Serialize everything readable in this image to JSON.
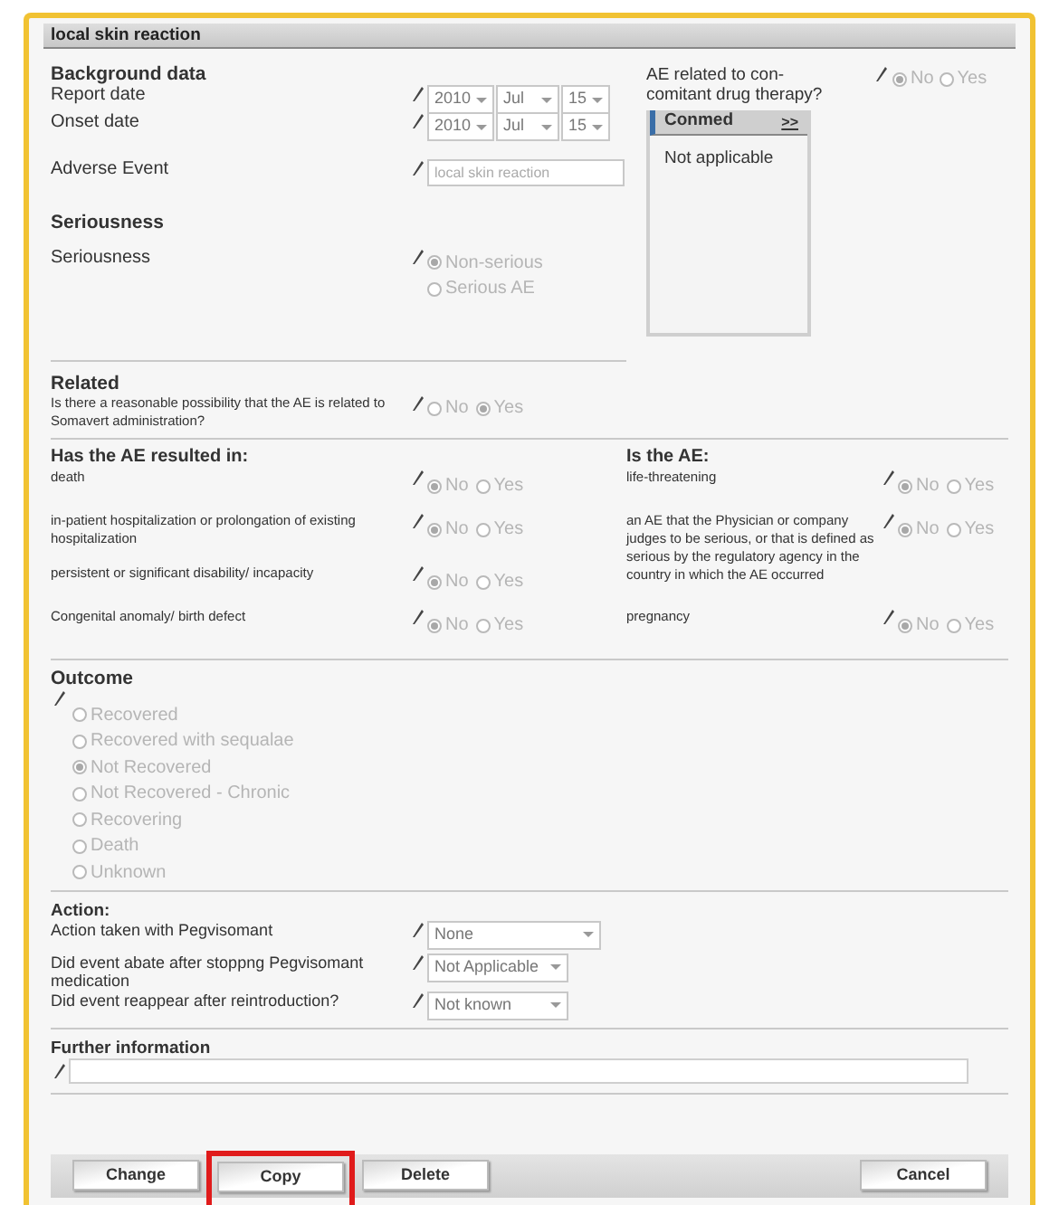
{
  "panel": {
    "title": "local skin reaction"
  },
  "background": {
    "heading": "Background data",
    "dates": [
      {
        "label": "Report date",
        "year": "2010",
        "month": "Jul",
        "day": "15"
      },
      {
        "label": "Onset date",
        "year": "2010",
        "month": "Jul",
        "day": "15"
      }
    ],
    "adverse_event": {
      "label": "Adverse Event",
      "value": "local skin reaction"
    }
  },
  "conmed": {
    "question": "AE related to con-comitant drug therapy?",
    "options": [
      {
        "label": "No",
        "selected": true
      },
      {
        "label": "Yes",
        "selected": false
      }
    ],
    "box_title": "Conmed",
    "expand": ">>",
    "content": "Not applicable"
  },
  "seriousness": {
    "heading": "Seriousness",
    "label": "Seriousness",
    "options": [
      {
        "label": "Non-serious",
        "selected": true
      },
      {
        "label": "Serious AE",
        "selected": false
      }
    ]
  },
  "related": {
    "heading": "Related",
    "question": "Is there a reasonable possibility that the AE is related to Somavert administration?",
    "options": [
      {
        "label": "No",
        "selected": false
      },
      {
        "label": "Yes",
        "selected": true
      }
    ]
  },
  "resulted_in": {
    "heading": "Has the AE resulted in:",
    "items": [
      {
        "label": "death",
        "options": [
          {
            "label": "No",
            "selected": true
          },
          {
            "label": "Yes",
            "selected": false
          }
        ]
      },
      {
        "label": "in-patient hospitalization or prolongation of existing hospitalization",
        "options": [
          {
            "label": "No",
            "selected": true
          },
          {
            "label": "Yes",
            "selected": false
          }
        ]
      },
      {
        "label": "persistent or significant disability/ incapacity",
        "options": [
          {
            "label": "No",
            "selected": true
          },
          {
            "label": "Yes",
            "selected": false
          }
        ]
      },
      {
        "label": "Congenital anomaly/ birth defect",
        "options": [
          {
            "label": "No",
            "selected": true
          },
          {
            "label": "Yes",
            "selected": false
          }
        ]
      }
    ]
  },
  "is_the_ae": {
    "heading": "Is the AE:",
    "items": [
      {
        "label": "life-threatening",
        "options": [
          {
            "label": "No",
            "selected": true
          },
          {
            "label": "Yes",
            "selected": false
          }
        ]
      },
      {
        "label": "an AE that the Physician or company judges to be serious, or that is defined as serious by the regulatory agency in the country in which the AE occurred",
        "options": [
          {
            "label": "No",
            "selected": true
          },
          {
            "label": "Yes",
            "selected": false
          }
        ]
      },
      {
        "label": "pregnancy",
        "options": [
          {
            "label": "No",
            "selected": true
          },
          {
            "label": "Yes",
            "selected": false
          }
        ]
      }
    ]
  },
  "outcome": {
    "heading": "Outcome",
    "options": [
      {
        "label": "Recovered",
        "selected": false
      },
      {
        "label": "Recovered with sequalae",
        "selected": false
      },
      {
        "label": "Not Recovered",
        "selected": true
      },
      {
        "label": "Not Recovered - Chronic",
        "selected": false
      },
      {
        "label": "Recovering",
        "selected": false
      },
      {
        "label": "Death",
        "selected": false
      },
      {
        "label": "Unknown",
        "selected": false
      }
    ]
  },
  "action": {
    "heading": "Action:",
    "items": [
      {
        "label": "Action taken with Pegvisomant",
        "value": "None"
      },
      {
        "label": "Did event abate after stoppng Pegvisomant medication",
        "value": "Not Applicable"
      },
      {
        "label": "Did event reappear after reintroduction?",
        "value": "Not known"
      }
    ]
  },
  "further_information": {
    "heading": "Further information"
  },
  "buttons": [
    {
      "label": "Change",
      "highlighted": false
    },
    {
      "label": "Copy",
      "highlighted": true
    },
    {
      "label": "Delete",
      "highlighted": false
    },
    {
      "label": "Cancel",
      "highlighted": false
    }
  ]
}
